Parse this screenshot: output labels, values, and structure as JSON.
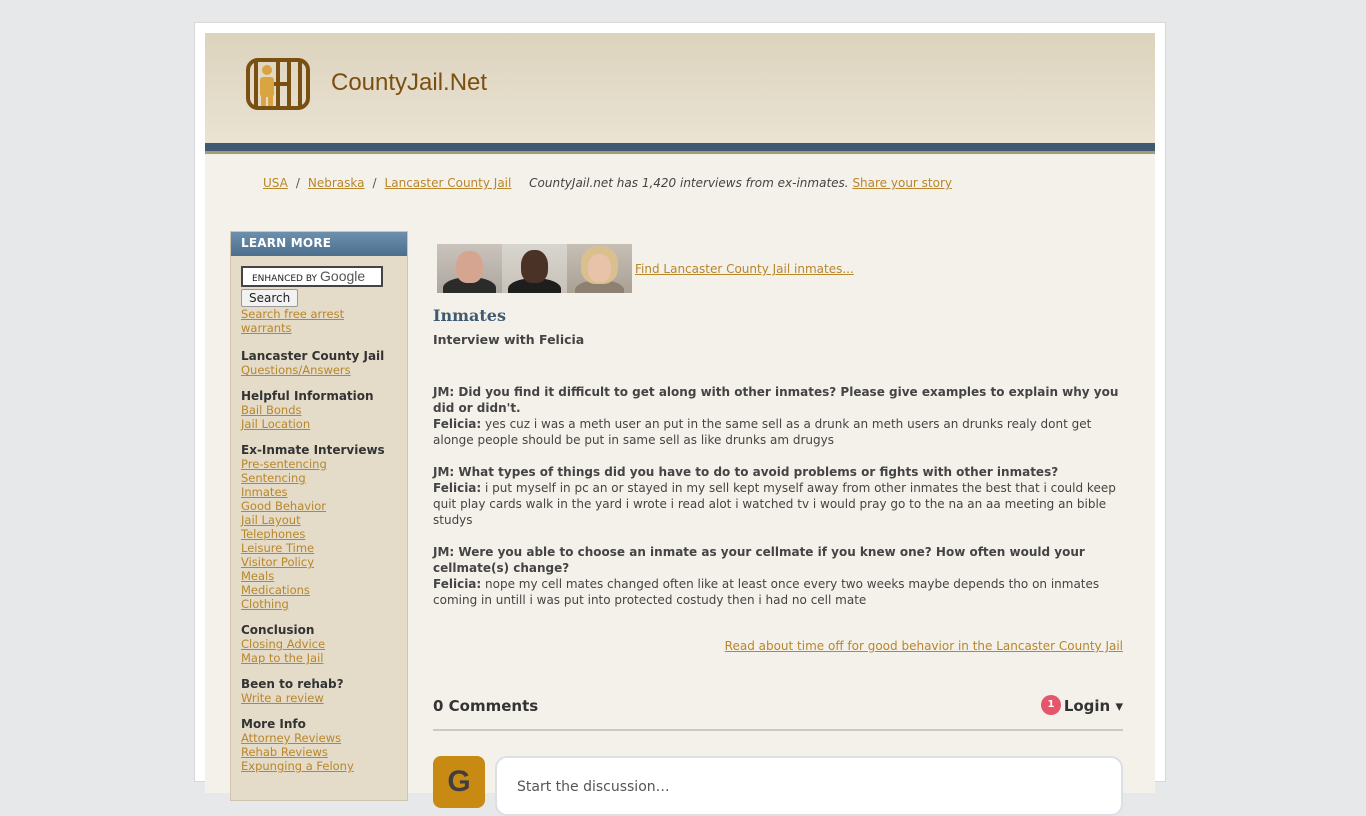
{
  "site": {
    "name": "CountyJail.Net",
    "colors": {
      "header_band": "#3f5b72",
      "link": "#b8862b",
      "sidebar_head": "#5b7d9c",
      "badge": "#e5566b",
      "avatar": "#c98a14"
    }
  },
  "breadcrumb": {
    "items": [
      "USA",
      "Nebraska",
      "Lancaster County Jail"
    ],
    "separator": "/",
    "count_text": "CountyJail.net has 1,420 interviews from ex-inmates.",
    "share_link": "Share your story"
  },
  "sidebar": {
    "header": "LEARN MORE",
    "search_box_label": "ENHANCED BY",
    "search_box_brand": "Google",
    "search_button": "Search",
    "warrants_link": "Search free arrest warrants",
    "sections": [
      {
        "title": "Lancaster County Jail",
        "links": [
          "Questions/Answers"
        ]
      },
      {
        "title": "Helpful Information",
        "links": [
          "Bail Bonds",
          "Jail Location"
        ]
      },
      {
        "title": "Ex-Inmate Interviews",
        "links": [
          "Pre-sentencing",
          "Sentencing",
          "Inmates",
          "Good Behavior",
          "Jail Layout",
          "Telephones",
          "Leisure Time",
          "Visitor Policy",
          "Meals",
          "Medications",
          "Clothing"
        ]
      },
      {
        "title": "Conclusion",
        "links": [
          "Closing Advice",
          "Map to the Jail"
        ]
      },
      {
        "title": "Been to rehab?",
        "links": [
          "Write a review"
        ]
      },
      {
        "title": "More Info",
        "links": [
          "Attorney Reviews",
          "Rehab Reviews",
          "Expunging a Felony"
        ]
      }
    ]
  },
  "main": {
    "find_link": "Find Lancaster County Jail inmates...",
    "heading": "Inmates",
    "subheading": "Interview with Felicia",
    "qa": [
      {
        "q": "JM: Did you find it difficult to get along with other inmates? Please give examples to explain why you did or didn't.",
        "speaker": "Felicia:",
        "a": "yes cuz i was a meth user an put in the same sell as a drunk an meth users an drunks realy dont get alonge people should be put in same sell as like drunks am drugys"
      },
      {
        "q": "JM: What types of things did you have to do to avoid problems or fights with other inmates?",
        "speaker": "Felicia:",
        "a": "i put myself in pc an or stayed in my sell kept myself away from other inmates the best that i could keep quit play cards walk in the yard i wrote i read alot i watched tv i would pray go to the na an aa meeting an bible studys"
      },
      {
        "q": "JM: Were you able to choose an inmate as your cellmate if you knew one? How often would your cellmate(s) change?",
        "speaker": "Felicia:",
        "a": "nope my cell mates changed often like at least once every two weeks maybe depends tho on inmates coming in untill i was put into protected costudy then i had no cell mate"
      }
    ],
    "good_behavior_link": "Read about time off for good behavior in the Lancaster County Jail"
  },
  "comments": {
    "count_label": "0 Comments",
    "badge": "1",
    "login": "Login ▾",
    "avatar_letter": "G",
    "placeholder": "Start the discussion…"
  }
}
